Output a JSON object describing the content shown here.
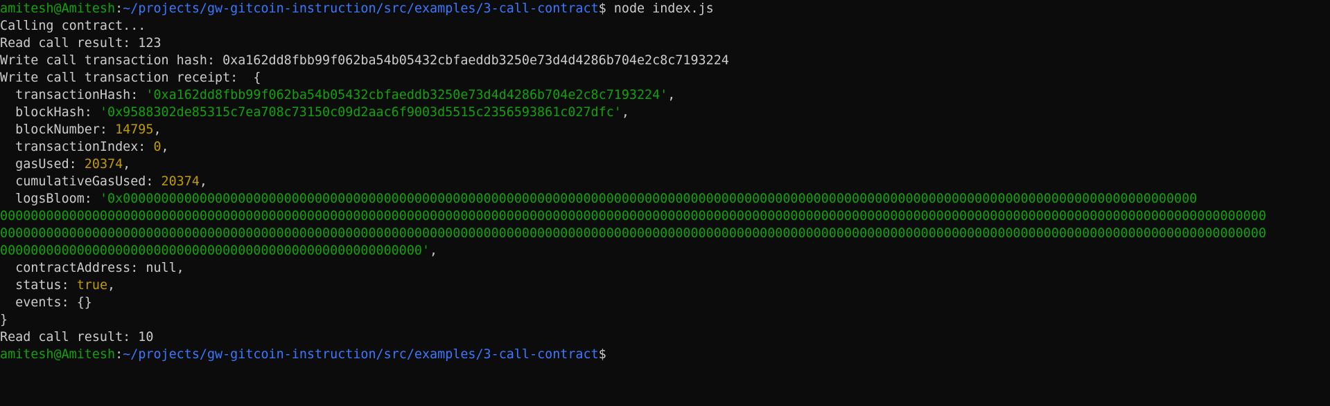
{
  "prompt": {
    "user_host": "amitesh@Amitesh",
    "sep": ":",
    "path": "~/projects/gw-gitcoin-instruction/src/examples/3-call-contract",
    "symbol": "$"
  },
  "command": " node index.js",
  "output": {
    "calling": "Calling contract...",
    "read1": "Read call result: 123",
    "write_hash": "Write call transaction hash: 0xa162dd8fbb99f062ba54b05432cbfaeddb3250e73d4d4286b704e2c8c7193224",
    "receipt_header": "Write call transaction receipt:  {",
    "receipt": {
      "transactionHash_key": "  transactionHash: ",
      "transactionHash_val": "'0xa162dd8fbb99f062ba54b05432cbfaeddb3250e73d4d4286b704e2c8c7193224'",
      "blockHash_key": "  blockHash: ",
      "blockHash_val": "'0x9588302de85315c7ea708c73150c09d2aac6f9003d5515c2356593861c027dfc'",
      "blockNumber_key": "  blockNumber: ",
      "blockNumber_val": "14795",
      "transactionIndex_key": "  transactionIndex: ",
      "transactionIndex_val": "0",
      "gasUsed_key": "  gasUsed: ",
      "gasUsed_val": "20374",
      "cumulativeGasUsed_key": "  cumulativeGasUsed: ",
      "cumulativeGasUsed_val": "20374",
      "logsBloom_key": "  logsBloom: ",
      "logsBloom_line1": "'0x00000000000000000000000000000000000000000000000000000000000000000000000000000000000000000000000000000000000000000000000000000000000000000000",
      "logsBloom_line2": "000000000000000000000000000000000000000000000000000000000000000000000000000000000000000000000000000000000000000000000000000000000000000000000000000000000000000000000",
      "logsBloom_line3": "000000000000000000000000000000000000000000000000000000000000000000000000000000000000000000000000000000000000000000000000000000000000000000000000000000000000000000000",
      "logsBloom_line4": "0000000000000000000000000000000000000000000000000000000'",
      "contractAddress": "  contractAddress: null,",
      "status_key": "  status: ",
      "status_val": "true",
      "events": "  events: {}"
    },
    "receipt_close": "}",
    "read2": "Read call result: 10"
  },
  "punct": {
    "comma": ","
  }
}
